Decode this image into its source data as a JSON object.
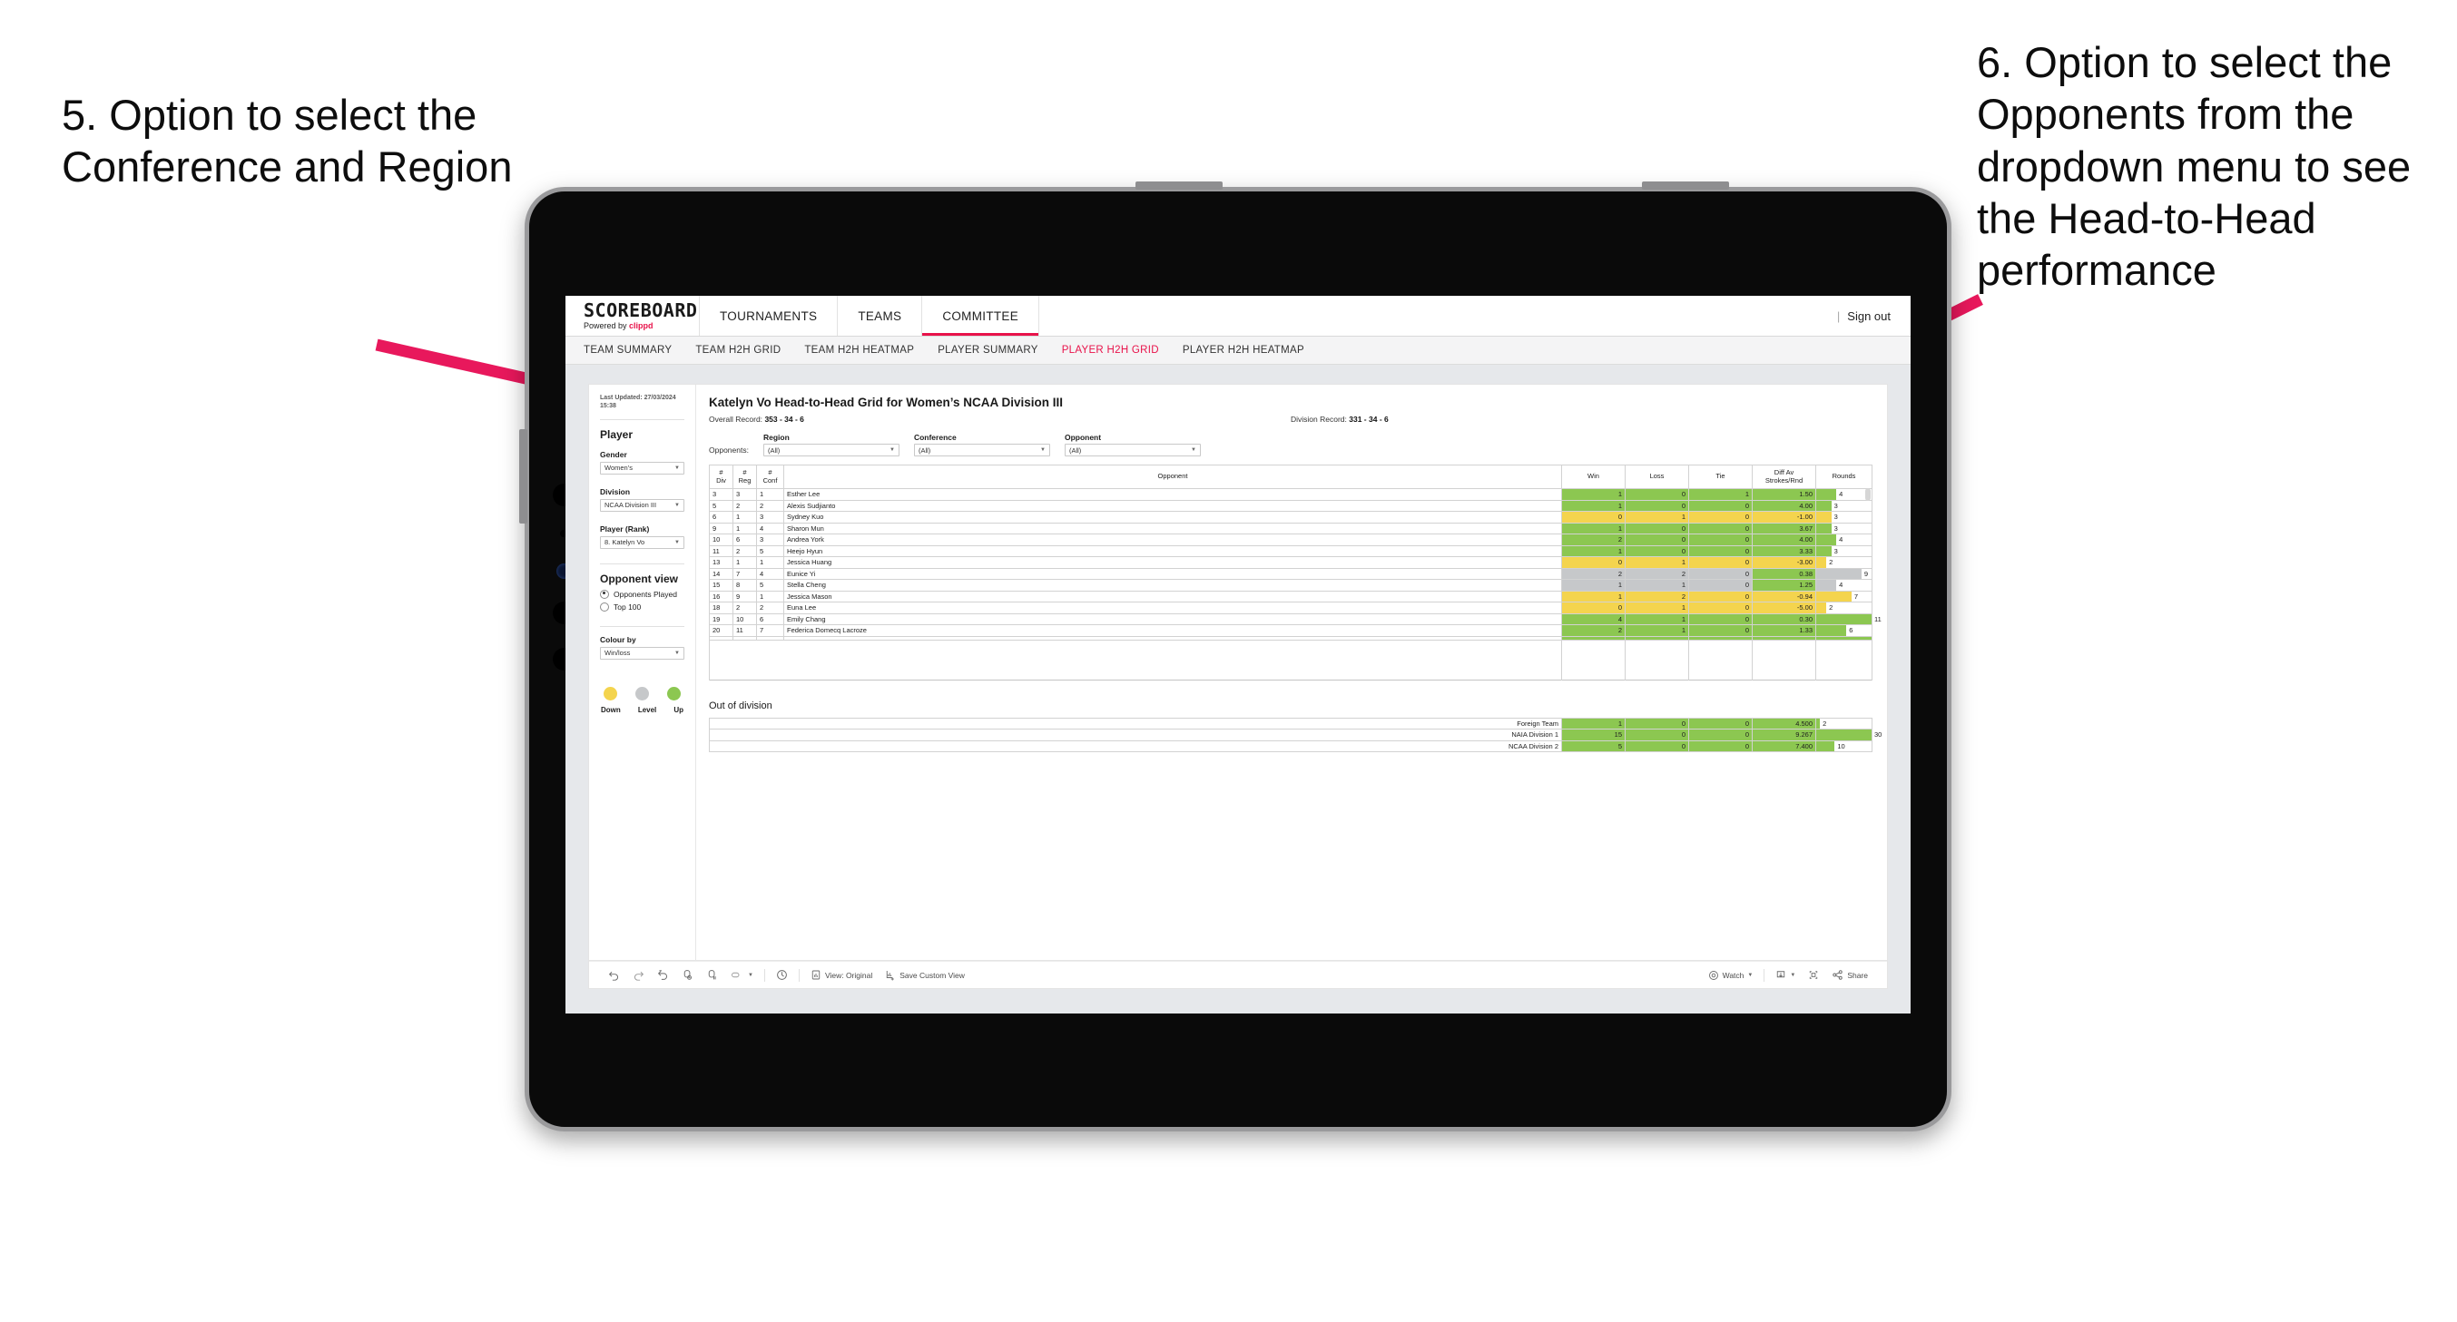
{
  "annotations": {
    "left": "5. Option to select the Conference and Region",
    "right": "6. Option to select the Opponents from the dropdown menu to see the Head-to-Head performance",
    "arrow_color": "#E8185C"
  },
  "topnav": {
    "logo_word": "SCOREBOARD",
    "logo_sub_prefix": "Powered by",
    "logo_sub_brand": "clippd",
    "items": [
      {
        "label": "TOURNAMENTS",
        "active": false
      },
      {
        "label": "TEAMS",
        "active": false
      },
      {
        "label": "COMMITTEE",
        "active": true
      }
    ],
    "separator": "|",
    "signout": "Sign out"
  },
  "subnav": {
    "items": [
      {
        "label": "TEAM SUMMARY",
        "active": false
      },
      {
        "label": "TEAM H2H GRID",
        "active": false
      },
      {
        "label": "TEAM H2H HEATMAP",
        "active": false
      },
      {
        "label": "PLAYER SUMMARY",
        "active": false
      },
      {
        "label": "PLAYER H2H GRID",
        "active": true
      },
      {
        "label": "PLAYER H2H HEATMAP",
        "active": false
      }
    ],
    "active_color": "#E8124A"
  },
  "left_panel": {
    "last_updated": "Last Updated: 27/03/2024 15:38",
    "section_player": "Player",
    "gender": {
      "label": "Gender",
      "value": "Women’s"
    },
    "division": {
      "label": "Division",
      "value": "NCAA Division III"
    },
    "player_rank": {
      "label": "Player (Rank)",
      "value": "8. Katelyn Vo"
    },
    "opponent_view": {
      "heading": "Opponent view",
      "options": [
        {
          "label": "Opponents Played",
          "selected": true
        },
        {
          "label": "Top 100",
          "selected": false
        }
      ]
    },
    "colour_by": {
      "label": "Colour by",
      "value": "Win/loss"
    },
    "legend": {
      "items": [
        {
          "label": "Down",
          "color": "#F4D44E"
        },
        {
          "label": "Level",
          "color": "#C6C8CA"
        },
        {
          "label": "Up",
          "color": "#8CC751"
        }
      ]
    }
  },
  "viz": {
    "title": "Katelyn Vo Head-to-Head Grid for Women’s NCAA Division III",
    "overall_record_label": "Overall Record:",
    "overall_record_value": "353 - 34 - 6",
    "division_record_label": "Division Record:",
    "division_record_value": "331 - 34 - 6",
    "opponents_label": "Opponents:",
    "filters": [
      {
        "label": "Region",
        "value": "(All)"
      },
      {
        "label": "Conference",
        "value": "(All)"
      },
      {
        "label": "Opponent",
        "value": "(All)"
      }
    ],
    "out_of_division_title": "Out of division"
  },
  "chart_data": {
    "type": "table",
    "title": "Katelyn Vo Head-to-Head Grid for Women’s NCAA Division III",
    "columns": [
      "# Div",
      "# Reg",
      "# Conf",
      "Opponent",
      "Win",
      "Loss",
      "Tie",
      "Diff Av Strokes/Rnd",
      "Rounds"
    ],
    "column_headers_multiline": [
      [
        "#",
        "Div"
      ],
      [
        "#",
        "Reg"
      ],
      [
        "#",
        "Conf"
      ],
      [
        "",
        "Opponent"
      ],
      [
        "",
        "Win"
      ],
      [
        "",
        "Loss"
      ],
      [
        "",
        "Tie"
      ],
      [
        "Diff Av",
        "Strokes/Rnd"
      ],
      [
        "",
        "Rounds"
      ]
    ],
    "rounds_max": 11,
    "colors": {
      "up": "#8CC751",
      "down": "#F4D44E",
      "level": "#C6C8CA",
      "white": "#FFFFFF"
    },
    "rows": [
      {
        "div": "3",
        "reg": "3",
        "conf": "1",
        "opponent": "Esther Lee",
        "win": "1",
        "loss": "0",
        "tie": "1",
        "diff": "1.50",
        "rounds": 4,
        "state": "up"
      },
      {
        "div": "5",
        "reg": "2",
        "conf": "2",
        "opponent": "Alexis Sudjianto",
        "win": "1",
        "loss": "0",
        "tie": "0",
        "diff": "4.00",
        "rounds": 3,
        "state": "up"
      },
      {
        "div": "6",
        "reg": "1",
        "conf": "3",
        "opponent": "Sydney Kuo",
        "win": "0",
        "loss": "1",
        "tie": "0",
        "diff": "-1.00",
        "rounds": 3,
        "state": "down"
      },
      {
        "div": "9",
        "reg": "1",
        "conf": "4",
        "opponent": "Sharon Mun",
        "win": "1",
        "loss": "0",
        "tie": "0",
        "diff": "3.67",
        "rounds": 3,
        "state": "up"
      },
      {
        "div": "10",
        "reg": "6",
        "conf": "3",
        "opponent": "Andrea York",
        "win": "2",
        "loss": "0",
        "tie": "0",
        "diff": "4.00",
        "rounds": 4,
        "state": "up"
      },
      {
        "div": "11",
        "reg": "2",
        "conf": "5",
        "opponent": "Heejo Hyun",
        "win": "1",
        "loss": "0",
        "tie": "0",
        "diff": "3.33",
        "rounds": 3,
        "state": "up"
      },
      {
        "div": "13",
        "reg": "1",
        "conf": "1",
        "opponent": "Jessica Huang",
        "win": "0",
        "loss": "1",
        "tie": "0",
        "diff": "-3.00",
        "rounds": 2,
        "state": "down"
      },
      {
        "div": "14",
        "reg": "7",
        "conf": "4",
        "opponent": "Eunice Yi",
        "win": "2",
        "loss": "2",
        "tie": "0",
        "diff": "0.38",
        "rounds": 9,
        "state": "level",
        "diff_state": "up"
      },
      {
        "div": "15",
        "reg": "8",
        "conf": "5",
        "opponent": "Stella Cheng",
        "win": "1",
        "loss": "1",
        "tie": "0",
        "diff": "1.25",
        "rounds": 4,
        "state": "level",
        "diff_state": "up"
      },
      {
        "div": "16",
        "reg": "9",
        "conf": "1",
        "opponent": "Jessica Mason",
        "win": "1",
        "loss": "2",
        "tie": "0",
        "diff": "-0.94",
        "rounds": 7,
        "state": "down"
      },
      {
        "div": "18",
        "reg": "2",
        "conf": "2",
        "opponent": "Euna Lee",
        "win": "0",
        "loss": "1",
        "tie": "0",
        "diff": "-5.00",
        "rounds": 2,
        "state": "down"
      },
      {
        "div": "19",
        "reg": "10",
        "conf": "6",
        "opponent": "Emily Chang",
        "win": "4",
        "loss": "1",
        "tie": "0",
        "diff": "0.30",
        "rounds": 11,
        "state": "up"
      },
      {
        "div": "20",
        "reg": "11",
        "conf": "7",
        "opponent": "Federica Domecq Lacroze",
        "win": "2",
        "loss": "1",
        "tie": "0",
        "diff": "1.33",
        "rounds": 6,
        "state": "up"
      }
    ],
    "out_of_division": {
      "rounds_max": 30,
      "rows": [
        {
          "label": "Foreign Team",
          "win": "1",
          "loss": "0",
          "tie": "0",
          "diff": "4.500",
          "rounds": 2,
          "state": "up"
        },
        {
          "label": "NAIA Division 1",
          "win": "15",
          "loss": "0",
          "tie": "0",
          "diff": "9.267",
          "rounds": 30,
          "state": "up"
        },
        {
          "label": "NCAA Division 2",
          "win": "5",
          "loss": "0",
          "tie": "0",
          "diff": "7.400",
          "rounds": 10,
          "state": "up"
        }
      ]
    }
  },
  "toolbar": {
    "undo": "undo-icon",
    "redo": "redo-icon",
    "revert": "revert-icon",
    "refresh": "refresh-icon",
    "pause": "pause-icon",
    "highlight": "highlight-icon",
    "reset": "reset-icon",
    "view_original": "View: Original",
    "save_custom_view": "Save Custom View",
    "watch": "Watch",
    "download": "download-icon",
    "fullscreen": "fullscreen-icon",
    "share": "Share"
  }
}
